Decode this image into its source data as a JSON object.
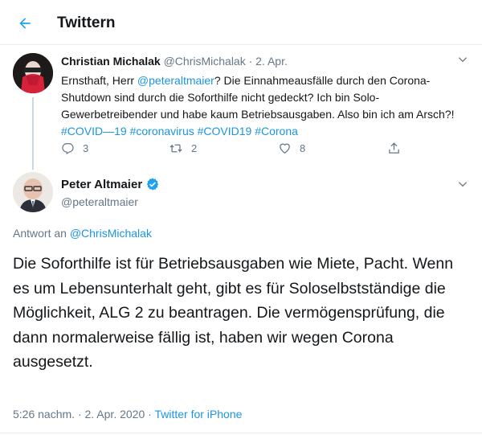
{
  "header": {
    "title": "Twittern",
    "back_icon": "arrow-left-icon"
  },
  "tweet1": {
    "name": "Christian Michalak",
    "handle": "@ChrisMichalak",
    "separator": "·",
    "date": "2. Apr.",
    "text_part1": "Ernsthaft, Herr ",
    "mention": "@peteraltmaier",
    "text_part2": "? Die Einnahmeausfälle durch den Corona-Shutdown sind durch die Soforthilfe nicht gedeckt? Ich bin Solo-Gewerbetreibender und habe kaum Betriebsausgaben. Also bin ich am Arsch?! ",
    "hashtags": "#COVID—19 #coronavirus #COVID19 #Corona",
    "replies": "3",
    "retweets": "2",
    "likes": "8"
  },
  "tweet2": {
    "name": "Peter Altmaier",
    "handle": "@peteraltmaier",
    "reply_prefix": "Antwort an ",
    "reply_to": "@ChrisMichalak",
    "text": "Die Soforthilfe ist für Betriebsausgaben wie Miete, Pacht. Wenn es um Lebensunterhalt geht, gibt es für Soloselbstständige die Möglichkeit,  ALG 2 zu beantragen. Die vermögensprüfung, die dann normalerweise fällig ist, haben wir wegen Corona ausgesetzt.",
    "time": "5:26 nachm.",
    "separator": "·",
    "date": "2. Apr. 2020",
    "source": "Twitter for iPhone"
  },
  "colors": {
    "accent": "#1da1f2",
    "link": "#1b95e0",
    "muted": "#657786",
    "border": "#e6ecf0"
  }
}
